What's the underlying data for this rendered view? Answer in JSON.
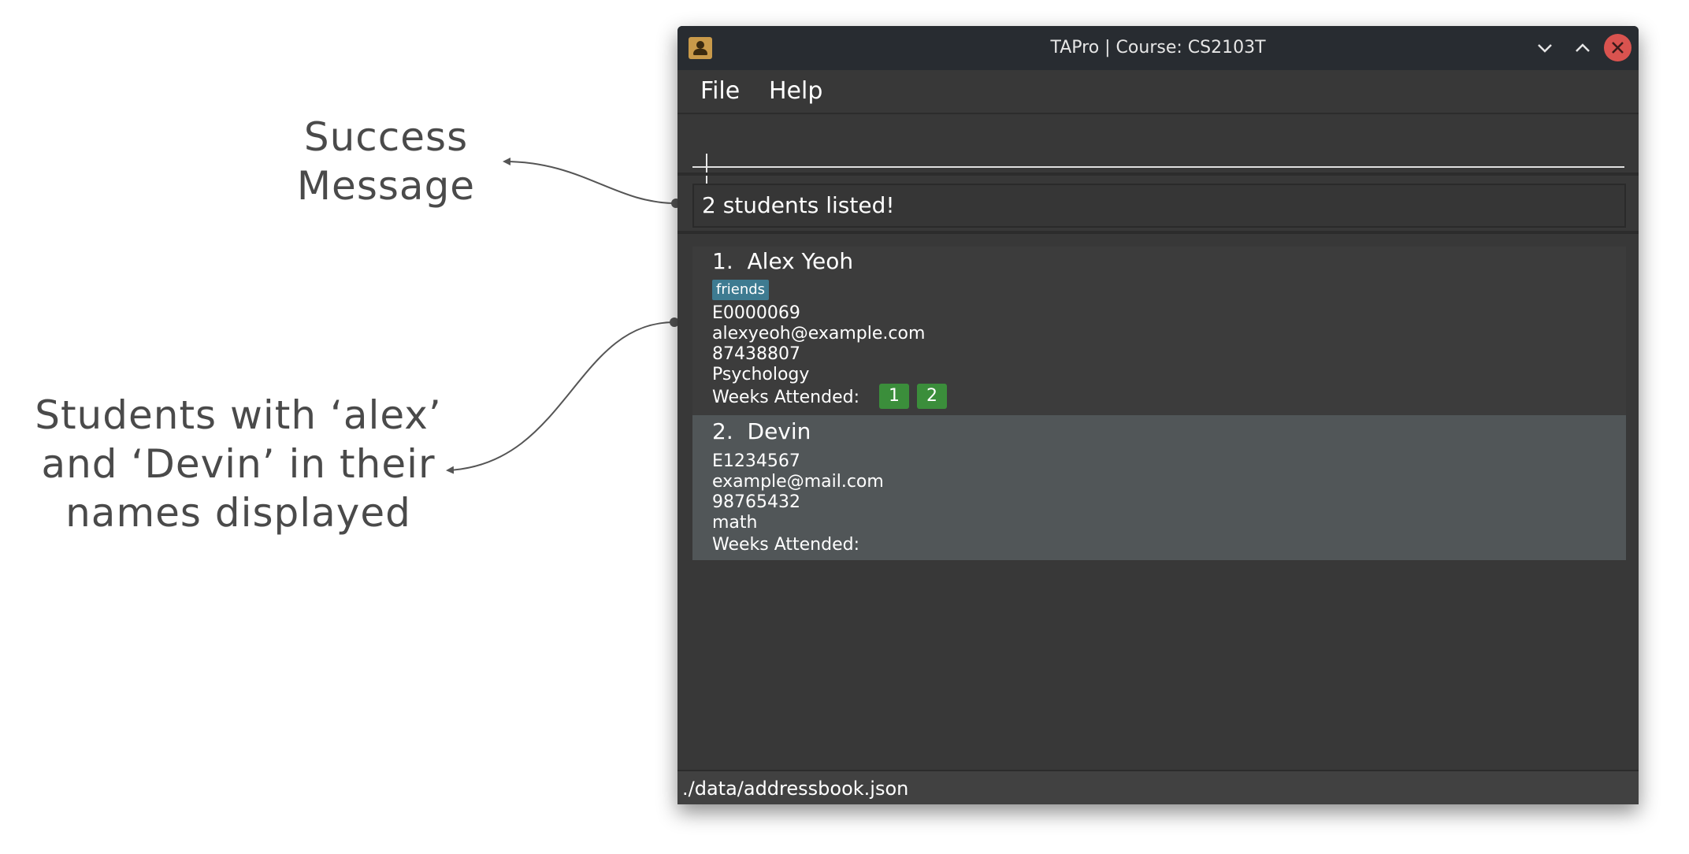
{
  "annotations": {
    "success": [
      "Success",
      "Message"
    ],
    "students": [
      "Students with ‘alex’",
      "and ‘Devin’ in their",
      "names displayed"
    ]
  },
  "window": {
    "title": "TAPro | Course: CS2103T",
    "controls": [
      "chevron-down-icon",
      "chevron-up-icon",
      "close-icon"
    ]
  },
  "menu": {
    "file": "File",
    "help": "Help"
  },
  "command_box": {
    "value": ""
  },
  "result": {
    "message": "2 students listed!"
  },
  "students": [
    {
      "name": "1.  Alex Yeoh",
      "tag": "friends",
      "id": "E0000069",
      "email": "alexyeoh@example.com",
      "phone": "87438807",
      "major": "Psychology",
      "weeks_label": "Weeks Attended:",
      "weeks": [
        "1",
        "2"
      ]
    },
    {
      "name": "2.  Devin",
      "id": "E1234567",
      "email": "example@mail.com",
      "phone": "98765432",
      "major": "math",
      "weeks_label": "Weeks Attended:",
      "weeks": []
    }
  ],
  "status_bar": {
    "path": "./data/addressbook.json"
  },
  "colors": {
    "window_bg": "#383838",
    "titlebar_bg": "#282c31",
    "close_button": "#d9534f",
    "tag_bg": "#3e7b91",
    "week_badge": "#3b8e3b",
    "selected_card": "#515658",
    "annotation_text": "#4a4a4a"
  }
}
